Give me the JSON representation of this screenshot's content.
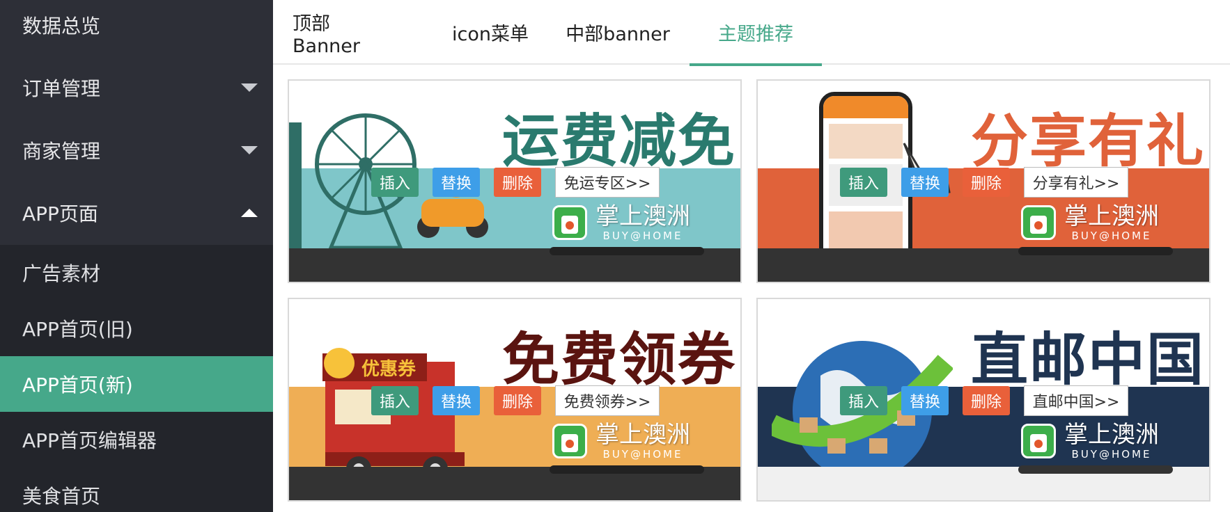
{
  "sidebar": {
    "items": [
      {
        "label": "数据总览"
      },
      {
        "label": "订单管理"
      },
      {
        "label": "商家管理"
      },
      {
        "label": "APP页面"
      }
    ],
    "submenu": [
      {
        "label": "广告素材"
      },
      {
        "label": "APP首页(旧)"
      },
      {
        "label": "APP首页(新)"
      },
      {
        "label": "APP首页编辑器"
      },
      {
        "label": "美食首页"
      }
    ]
  },
  "tabs": [
    {
      "label": "顶部Banner"
    },
    {
      "label": "icon菜单"
    },
    {
      "label": "中部banner"
    },
    {
      "label": "主题推荐"
    }
  ],
  "actions": {
    "insert": "插入",
    "replace": "替换",
    "delete": "删除"
  },
  "logo": {
    "cn": "掌上澳洲",
    "en": "BUY@HOME"
  },
  "cards": [
    {
      "title": "运费减免",
      "link": "免运专区>>",
      "band_color": "#7fc6c9",
      "title_color": "#2a7a6e"
    },
    {
      "title": "分享有礼",
      "link": "分享有礼>>",
      "band_color": "#e0623a",
      "title_color": "#e0623a"
    },
    {
      "title": "免费领券",
      "link": "免费领券>>",
      "band_color": "#efae55",
      "title_color": "#5a1410",
      "badge": "优惠券"
    },
    {
      "title": "直邮中国",
      "link": "直邮中国>>",
      "band_color": "#1f3451",
      "title_color": "#1f3451"
    }
  ],
  "colors": {
    "accent": "#46a88a",
    "sidebar_bg": "#2d2f37"
  }
}
